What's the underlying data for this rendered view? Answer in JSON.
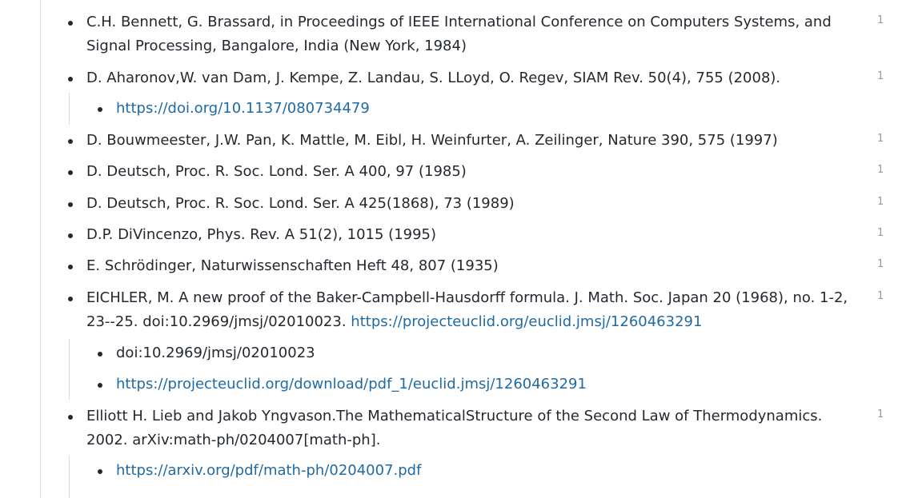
{
  "references": [
    {
      "text": "C.H. Bennett, G. Brassard, in Proceedings of IEEE International Conference on Computers Systems, and Signal Processing, Bangalore, India (New York, 1984)",
      "count": "1"
    },
    {
      "text": "D. Aharonov,W. van Dam, J. Kempe, Z. Landau, S. LLoyd, O. Regev, SIAM Rev. 50(4), 755 (2008).",
      "count": "1",
      "sub": [
        "https://doi.org/10.1137/080734479"
      ]
    },
    {
      "text": "D. Bouwmeester, J.W. Pan, K. Mattle, M. Eibl, H. Weinfurter, A. Zeilinger, Nature 390, 575 (1997)",
      "count": "1"
    },
    {
      "text": "D. Deutsch, Proc. R. Soc. Lond. Ser. A 400, 97 (1985)",
      "count": "1"
    },
    {
      "text": "D. Deutsch, Proc. R. Soc. Lond. Ser. A 425(1868), 73 (1989)",
      "count": "1"
    },
    {
      "text": "D.P. DiVincenzo, Phys. Rev. A 51(2), 1015 (1995)",
      "count": "1"
    },
    {
      "text": "E. Schrödinger, Naturwissenschaften Heft 48, 807 (1935)",
      "count": "1"
    },
    {
      "text": "EICHLER, M. A new proof of the Baker-Campbell-Hausdorff formula. J. Math. Soc. Japan 20 (1968), no. 1-2, 23--25. doi:10.2969/jmsj/02010023. ",
      "link": "https://projecteuclid.org/euclid.jmsj/1260463291",
      "count": "1",
      "sub": [
        "doi:10.2969/jmsj/02010023",
        "https://projecteuclid.org/download/pdf_1/euclid.jmsj/1260463291"
      ]
    },
    {
      "text": "Elliott H. Lieb and Jakob Yngvason.The MathematicalStructure of the Second Law of Thermodynamics. 2002. arXiv:math-ph/0204007[math-ph].",
      "count": "1",
      "sub": [
        "https://arxiv.org/pdf/math-ph/0204007.pdf"
      ]
    }
  ]
}
